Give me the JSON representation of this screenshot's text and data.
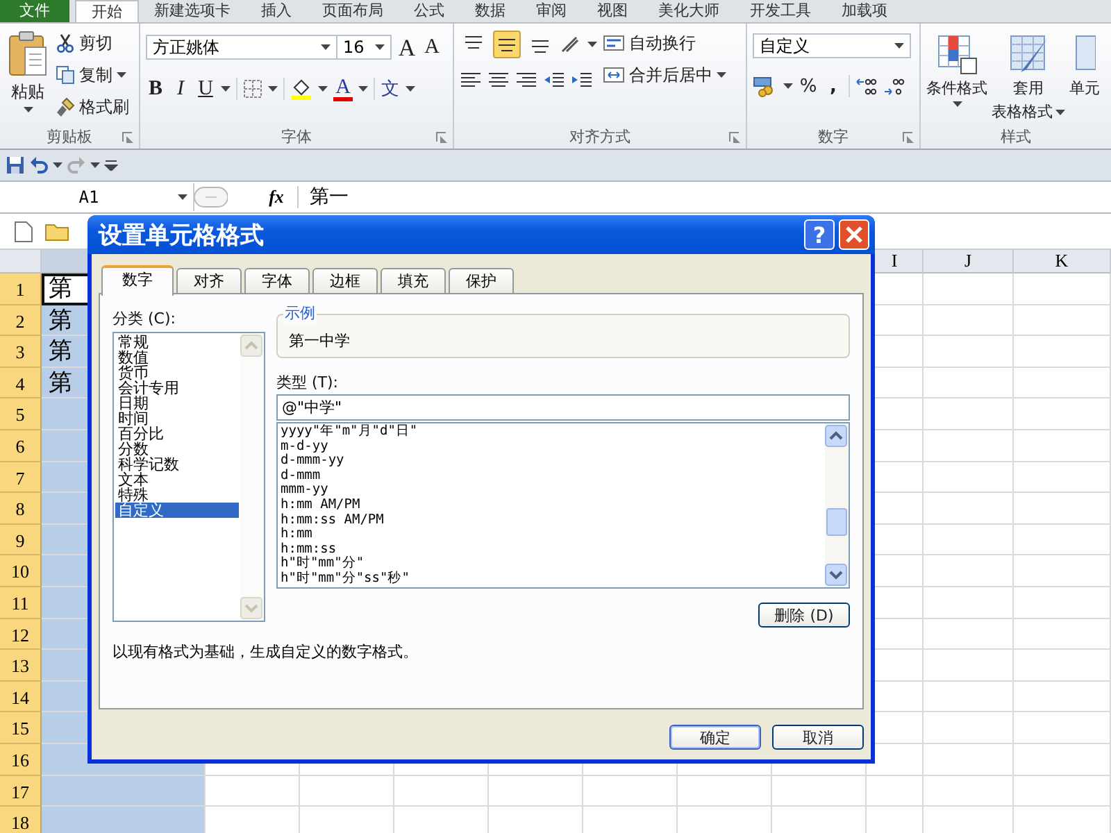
{
  "ribbon_tabs": [
    {
      "label": "文件",
      "kind": "file",
      "selected": false
    },
    {
      "label": "开始",
      "kind": "tab",
      "selected": true
    },
    {
      "label": "新建选项卡",
      "kind": "tab",
      "selected": false
    },
    {
      "label": "插入",
      "kind": "tab",
      "selected": false
    },
    {
      "label": "页面布局",
      "kind": "tab",
      "selected": false
    },
    {
      "label": "公式",
      "kind": "tab",
      "selected": false
    },
    {
      "label": "数据",
      "kind": "tab",
      "selected": false
    },
    {
      "label": "审阅",
      "kind": "tab",
      "selected": false
    },
    {
      "label": "视图",
      "kind": "tab",
      "selected": false
    },
    {
      "label": "美化大师",
      "kind": "tab",
      "selected": false
    },
    {
      "label": "开发工具",
      "kind": "tab",
      "selected": false
    },
    {
      "label": "加载项",
      "kind": "tab",
      "selected": false
    }
  ],
  "clipboard": {
    "paste": "粘贴",
    "cut": "剪切",
    "copy": "复制",
    "format_painter": "格式刷",
    "group_label": "剪贴板"
  },
  "font": {
    "name": "方正姚体",
    "size": "16",
    "grow": "A",
    "shrink": "A",
    "bold": "B",
    "italic": "I",
    "underline": "U",
    "font_color": "A",
    "phonetic": "文",
    "group_label": "字体"
  },
  "alignment": {
    "vertical_align": [
      {
        "selected": false
      },
      {
        "selected": true
      },
      {
        "selected": false
      }
    ],
    "wrap": "自动换行",
    "merge": "合并后居中",
    "group_label": "对齐方式"
  },
  "number": {
    "format": "自定义",
    "percent": "%",
    "comma": ",",
    "group_label": "数字"
  },
  "styles": {
    "conditional": "条件格式",
    "table_format_1": "套用",
    "table_format_2": "表格格式",
    "cell_styles": "单元",
    "group_label": "样式"
  },
  "formula_bar": {
    "name_box": "A1",
    "function_label": "fx",
    "content": "第一"
  },
  "sheet": {
    "column_headers": [
      "I",
      "J",
      "K"
    ],
    "row_headers": [
      "1",
      "2",
      "3",
      "4",
      "5",
      "6",
      "7",
      "8",
      "9",
      "10",
      "11",
      "12",
      "13",
      "14",
      "15",
      "16",
      "17",
      "18"
    ],
    "cells": [
      "第",
      "第",
      "第",
      "第"
    ]
  },
  "dialog": {
    "title": "设置单元格格式",
    "help": "?",
    "tabs": [
      {
        "label": "数字",
        "selected": true
      },
      {
        "label": "对齐",
        "selected": false
      },
      {
        "label": "字体",
        "selected": false
      },
      {
        "label": "边框",
        "selected": false
      },
      {
        "label": "填充",
        "selected": false
      },
      {
        "label": "保护",
        "selected": false
      }
    ],
    "category_label": "分类 (C):",
    "categories": [
      {
        "label": "常规",
        "selected": false
      },
      {
        "label": "数值",
        "selected": false
      },
      {
        "label": "货币",
        "selected": false
      },
      {
        "label": "会计专用",
        "selected": false
      },
      {
        "label": "日期",
        "selected": false
      },
      {
        "label": "时间",
        "selected": false
      },
      {
        "label": "百分比",
        "selected": false
      },
      {
        "label": "分数",
        "selected": false
      },
      {
        "label": "科学记数",
        "selected": false
      },
      {
        "label": "文本",
        "selected": false
      },
      {
        "label": "特殊",
        "selected": false
      },
      {
        "label": "自定义",
        "selected": true
      }
    ],
    "sample_label": "示例",
    "sample": "第一中学",
    "type_label": "类型 (T):",
    "type_value": "@\"中学\"",
    "formats": [
      "yyyy\"年\"m\"月\"d\"日\"",
      "m-d-yy",
      "d-mmm-yy",
      "d-mmm",
      "mmm-yy",
      "h:mm AM/PM",
      "h:mm:ss AM/PM",
      "h:mm",
      "h:mm:ss",
      "h\"时\"mm\"分\"",
      "h\"时\"mm\"分\"ss\"秒\""
    ],
    "delete_button": "删除 (D)",
    "description": "以现有格式为基础，生成自定义的数字格式。",
    "ok": "确定",
    "cancel": "取消"
  }
}
